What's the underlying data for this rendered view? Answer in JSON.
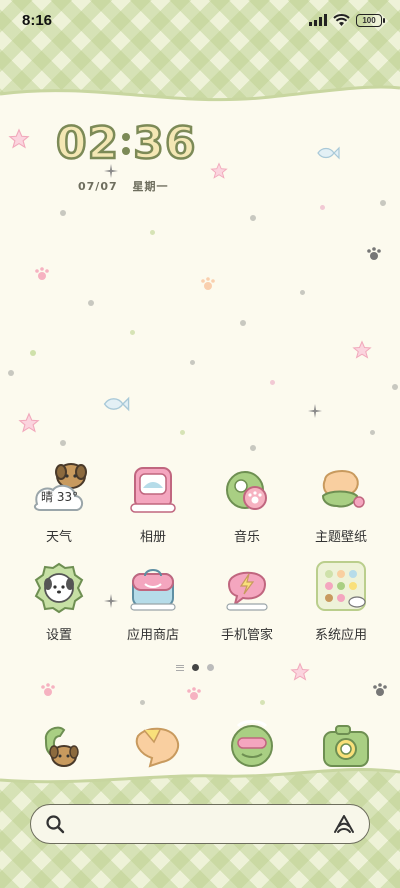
{
  "status_bar": {
    "time": "8:16",
    "battery": "100",
    "icons": [
      "signal-icon",
      "wifi-icon",
      "battery-icon"
    ]
  },
  "widget": {
    "clock": {
      "hour": "02",
      "minute": "36"
    },
    "date": {
      "day": "07/07",
      "weekday": "星期一"
    }
  },
  "apps": [
    {
      "label": "天气",
      "icon": "weather-dog-cloud-icon",
      "badge": "晴 33°"
    },
    {
      "label": "相册",
      "icon": "gallery-pink-box-icon"
    },
    {
      "label": "音乐",
      "icon": "music-paw-icon"
    },
    {
      "label": "主题壁纸",
      "icon": "theme-peach-icon"
    },
    {
      "label": "设置",
      "icon": "settings-dog-gear-icon"
    },
    {
      "label": "应用商店",
      "icon": "store-bag-icon"
    },
    {
      "label": "手机管家",
      "icon": "phone-manager-bubble-icon"
    },
    {
      "label": "系统应用",
      "icon": "system-apps-folder-icon"
    }
  ],
  "page_indicator": {
    "pages": 2,
    "active": 0
  },
  "dock": [
    {
      "icon": "phone-dog-icon"
    },
    {
      "icon": "messages-bird-icon"
    },
    {
      "icon": "browser-mask-icon"
    },
    {
      "icon": "camera-green-icon"
    }
  ],
  "search_bar": {
    "icons": [
      "search-icon",
      "assistant-icon"
    ]
  },
  "colors": {
    "background": "#fcfaee",
    "plaid": "#bace8c",
    "clock_outline": "#7c8a57",
    "clock_fill": "#f4e7b4",
    "accent_pink": "#f4a6bf",
    "accent_green": "#a9cf83"
  }
}
